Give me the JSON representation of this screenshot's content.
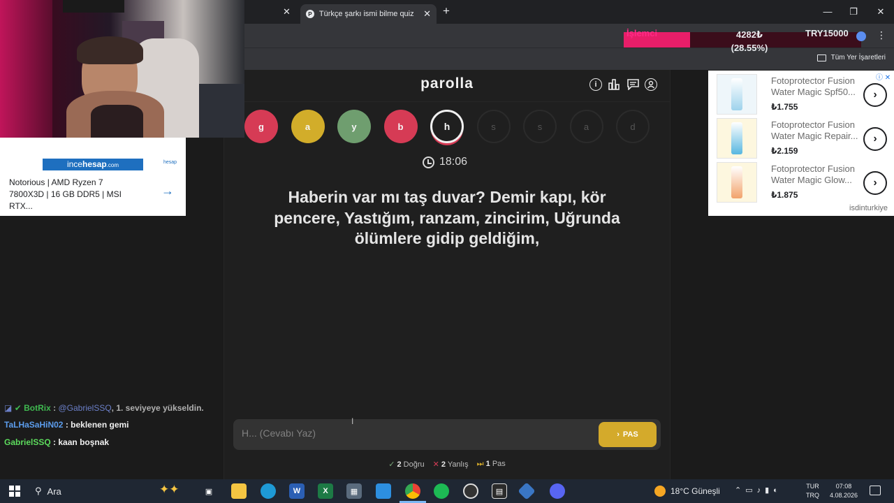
{
  "browser": {
    "tabs": [
      {
        "label": "",
        "active": false
      },
      {
        "label": "Türkçe şarkı ismi bilme quiz - p",
        "active": true
      }
    ],
    "new_tab": "+",
    "bookmarks_label": "Tüm Yer İşaretleri"
  },
  "overlay": {
    "cpu_label": "İşlemci",
    "cpu_value": "4282₺",
    "cpu_percent": "(28.55%)",
    "cpu_fraction": 0.2855,
    "money": "TRY15000"
  },
  "game": {
    "logo": "parolla",
    "letters": [
      {
        "char": "g",
        "state": "red"
      },
      {
        "char": "a",
        "state": "yellow"
      },
      {
        "char": "y",
        "state": "green"
      },
      {
        "char": "b",
        "state": "red"
      },
      {
        "char": "h",
        "state": "current"
      },
      {
        "char": "s",
        "state": "future"
      },
      {
        "char": "s",
        "state": "future"
      },
      {
        "char": "a",
        "state": "future"
      },
      {
        "char": "d",
        "state": "future"
      }
    ],
    "timer": "18:06",
    "question": "Haberin var mı taş duvar? Demir kapı, kör pencere, Yastığım, ranzam, zincirim, Uğrunda ölümlere gidip geldiğim,",
    "answer_placeholder": "H... (Cevabı Yaz)",
    "pas_label": "PAS",
    "stats": {
      "correct_count": "2",
      "correct_label": "Doğru",
      "wrong_count": "2",
      "wrong_label": "Yanlış",
      "pass_count": "1",
      "pass_label": "Pas"
    }
  },
  "left_ad": {
    "brand_a": "ince",
    "brand_b": "hesap",
    "brand_c": ".com",
    "small_brand": "hesap",
    "text": "Notorious | AMD Ryzen 7 7800X3D | 16 GB DDR5 | MSI RTX...",
    "arrow": "→"
  },
  "chat": [
    {
      "user": "BotRix",
      "mention": "@GabrielSSQ",
      "msg": ", 1. seviyeye yükseldin."
    },
    {
      "user": "TaLHaSaHiN02",
      "msg": ": beklenen gemi"
    },
    {
      "user": "GabrielSSQ",
      "msg": ": kaan boşnak"
    }
  ],
  "right_ad": {
    "products": [
      {
        "title": "Fotoprotector Fusion Water Magic Spf50...",
        "price": "₺1.755"
      },
      {
        "title": "Fotoprotector Fusion Water Magic Repair...",
        "price": "₺2.159"
      },
      {
        "title": "Fotoprotector Fusion Water Magic Glow...",
        "price": "₺1.875"
      }
    ],
    "brand": "isdinturkiye"
  },
  "taskbar": {
    "search": "Ara",
    "weather": "18°C Güneşli",
    "lang_top": "TUR",
    "lang_bottom": "TRQ",
    "time": "07:08",
    "date": "4.08.2026"
  },
  "colors": {
    "red": "#d63b55",
    "yellow": "#d2ad2a",
    "green": "#6f9e6f",
    "accent_pink": "#e81e69"
  }
}
